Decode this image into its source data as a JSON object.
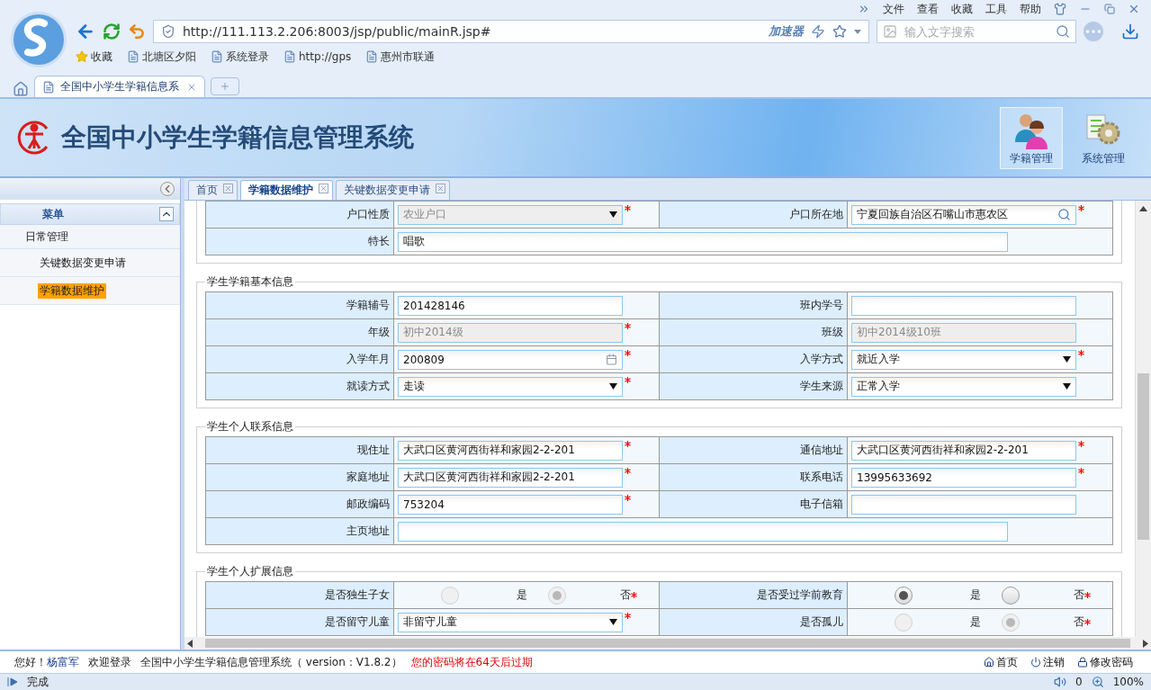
{
  "browser": {
    "window_menu": [
      "文件",
      "查看",
      "收藏",
      "工具",
      "帮助"
    ],
    "url": "http://111.113.2.206:8003/jsp/public/mainR.jsp#",
    "accelerator": "加速器",
    "search": {
      "placeholder": "输入文字搜索"
    },
    "bookmarks": [
      {
        "label": "收藏",
        "kind": "star"
      },
      {
        "label": "北塘区夕阳",
        "kind": "page"
      },
      {
        "label": "系统登录",
        "kind": "page"
      },
      {
        "label": "http://gps",
        "kind": "page"
      },
      {
        "label": "惠州市联通",
        "kind": "page"
      }
    ],
    "tab": {
      "title": "全国中小学生学籍信息系"
    },
    "status": {
      "text": "完成",
      "count": "0",
      "zoom": "100%"
    }
  },
  "app": {
    "title": "全国中小学生学籍信息管理系统",
    "nav": [
      {
        "label": "学籍管理",
        "kind": "people",
        "selected": true
      },
      {
        "label": "系统管理",
        "kind": "gear",
        "selected": false
      }
    ],
    "sidebar": {
      "title": "菜单",
      "group": "日常管理",
      "items": [
        {
          "label": "关键数据变更申请",
          "selected": false
        },
        {
          "label": "学籍数据维护",
          "selected": true
        }
      ]
    },
    "tabs": [
      {
        "label": "首页",
        "selected": false
      },
      {
        "label": "学籍数据维护",
        "selected": true
      },
      {
        "label": "关键数据变更申请",
        "selected": false
      }
    ],
    "sections": [
      {
        "rows": [
          {
            "cells": [
              {
                "label": "户口性质",
                "field": {
                  "kind": "select",
                  "value": "农业户口",
                  "disabled": true,
                  "required": true
                }
              },
              {
                "label": "户口所在地",
                "field": {
                  "kind": "lookup",
                  "value": "宁夏回族自治区石嘴山市惠农区",
                  "disabled": false,
                  "required": true
                }
              }
            ]
          },
          {
            "cells": [
              {
                "label": "特长",
                "field": {
                  "kind": "wide",
                  "value": "唱歌",
                  "disabled": false
                }
              }
            ]
          }
        ]
      },
      {
        "legend": "学生学籍基本信息",
        "rows": [
          {
            "cells": [
              {
                "label": "学籍辅号",
                "field": {
                  "kind": "text",
                  "value": "201428146",
                  "disabled": false
                }
              },
              {
                "label": "班内学号",
                "field": {
                  "kind": "text",
                  "disabled": false
                }
              }
            ]
          },
          {
            "cells": [
              {
                "label": "年级",
                "field": {
                  "kind": "text",
                  "value": "初中2014级",
                  "disabled": true,
                  "required": true
                }
              },
              {
                "label": "班级",
                "field": {
                  "kind": "text",
                  "value": "初中2014级10班",
                  "disabled": true
                }
              }
            ]
          },
          {
            "cells": [
              {
                "label": "入学年月",
                "field": {
                  "kind": "date",
                  "value": "200809",
                  "disabled": false,
                  "required": true
                }
              },
              {
                "label": "入学方式",
                "field": {
                  "kind": "select",
                  "value": "就近入学",
                  "disabled": false,
                  "required": true
                }
              }
            ]
          },
          {
            "cells": [
              {
                "label": "就读方式",
                "field": {
                  "kind": "select",
                  "value": "走读",
                  "disabled": false,
                  "required": true
                }
              },
              {
                "label": "学生来源",
                "field": {
                  "kind": "select",
                  "value": "正常入学",
                  "disabled": false
                }
              }
            ]
          }
        ]
      },
      {
        "legend": "学生个人联系信息",
        "rows": [
          {
            "cells": [
              {
                "label": "现住址",
                "field": {
                  "kind": "text",
                  "value": "大武口区黄河西街祥和家园2-2-201",
                  "disabled": false,
                  "required": true
                }
              },
              {
                "label": "通信地址",
                "field": {
                  "kind": "text",
                  "value": "大武口区黄河西街祥和家园2-2-201",
                  "disabled": false,
                  "required": true
                }
              }
            ]
          },
          {
            "cells": [
              {
                "label": "家庭地址",
                "field": {
                  "kind": "text",
                  "value": "大武口区黄河西街祥和家园2-2-201",
                  "disabled": false,
                  "required": true
                }
              },
              {
                "label": "联系电话",
                "field": {
                  "kind": "text",
                  "value": "13995633692",
                  "disabled": false,
                  "required": true
                }
              }
            ]
          },
          {
            "cells": [
              {
                "label": "邮政编码",
                "field": {
                  "kind": "text",
                  "value": "753204",
                  "disabled": false,
                  "required": true
                }
              },
              {
                "label": "电子信箱",
                "field": {
                  "kind": "text",
                  "disabled": false
                }
              }
            ]
          },
          {
            "cells": [
              {
                "label": "主页地址",
                "field": {
                  "kind": "wide",
                  "disabled": false
                }
              }
            ]
          }
        ]
      },
      {
        "legend": "学生个人扩展信息",
        "rows": [
          {
            "cells": [
              {
                "label": "是否独生子女",
                "field": {
                  "kind": "radio",
                  "disabled": true,
                  "required": true,
                  "options": [
                    {
                      "label": "是",
                      "selected": false
                    },
                    {
                      "label": "否",
                      "selected": true
                    }
                  ]
                }
              },
              {
                "label": "是否受过学前教育",
                "field": {
                  "kind": "radio",
                  "disabled": false,
                  "required": true,
                  "options": [
                    {
                      "label": "是",
                      "selected": true
                    },
                    {
                      "label": "否",
                      "selected": false
                    }
                  ]
                }
              }
            ]
          },
          {
            "cells": [
              {
                "label": "是否留守儿童",
                "field": {
                  "kind": "select",
                  "value": "非留守儿童",
                  "disabled": false,
                  "required": true
                }
              },
              {
                "label": "是否孤儿",
                "field": {
                  "kind": "radio",
                  "disabled": true,
                  "required": true,
                  "options": [
                    {
                      "label": "是",
                      "selected": false
                    },
                    {
                      "label": "否",
                      "selected": true
                    }
                  ]
                }
              }
            ]
          }
        ]
      }
    ],
    "status": {
      "greeting": "您好！",
      "user": "杨富军",
      "welcome": "欢迎登录",
      "system": "全国中小学生学籍信息管理系统（ version：V1.8.2）",
      "warning": "您的密码将在64天后过期",
      "links": [
        "首页",
        "注销",
        "修改密码"
      ]
    }
  }
}
